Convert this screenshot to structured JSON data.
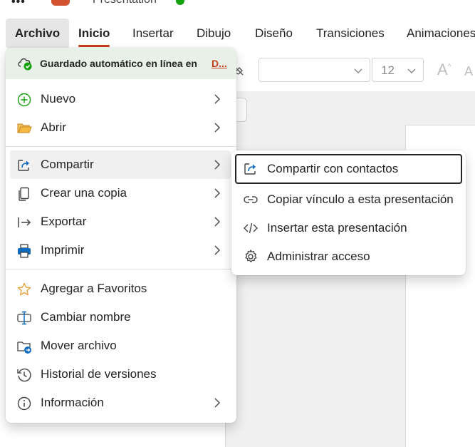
{
  "app": {
    "doc_title": "Presentation",
    "overflow_label": "•••"
  },
  "ribbon": {
    "tabs": [
      "Archivo",
      "Inicio",
      "Insertar",
      "Dibujo",
      "Diseño",
      "Transiciones",
      "Animaciones"
    ],
    "font_name": "",
    "font_size": "12",
    "grow_font_label": "A",
    "shrink_font_label": "A"
  },
  "file_menu": {
    "autosave_label": "Guardado automático en línea en",
    "autosave_link": "D...",
    "items": [
      {
        "label": "Nuevo",
        "icon": "plus-circle-icon",
        "has_submenu": true
      },
      {
        "label": "Abrir",
        "icon": "folder-open-icon",
        "has_submenu": true
      },
      {
        "label": "Compartir",
        "icon": "share-icon",
        "has_submenu": true,
        "selected": true
      },
      {
        "label": "Crear una copia",
        "icon": "copy-icon",
        "has_submenu": true
      },
      {
        "label": "Exportar",
        "icon": "export-icon",
        "has_submenu": true
      },
      {
        "label": "Imprimir",
        "icon": "printer-icon",
        "has_submenu": true
      },
      {
        "label": "Agregar a Favoritos",
        "icon": "star-icon",
        "has_submenu": false
      },
      {
        "label": "Cambiar nombre",
        "icon": "rename-icon",
        "has_submenu": false
      },
      {
        "label": "Mover archivo",
        "icon": "move-folder-icon",
        "has_submenu": false
      },
      {
        "label": "Historial de versiones",
        "icon": "history-icon",
        "has_submenu": false
      },
      {
        "label": "Información",
        "icon": "info-icon",
        "has_submenu": true
      }
    ]
  },
  "share_menu": {
    "items": [
      {
        "label": "Compartir con contactos",
        "icon": "share-icon",
        "focused": true
      },
      {
        "label": "Copiar vínculo a esta presentación",
        "icon": "link-icon"
      },
      {
        "label": "Insertar esta presentación",
        "icon": "embed-code-icon"
      },
      {
        "label": "Administrar acceso",
        "icon": "gear-icon"
      }
    ]
  },
  "colors": {
    "brand": "#c43e1c",
    "autosave_bg": "#e8f1e8",
    "share_icon_blue": "#0f6cbd",
    "plus_green": "#13a10e",
    "folder_orange": "#e8a13a"
  }
}
